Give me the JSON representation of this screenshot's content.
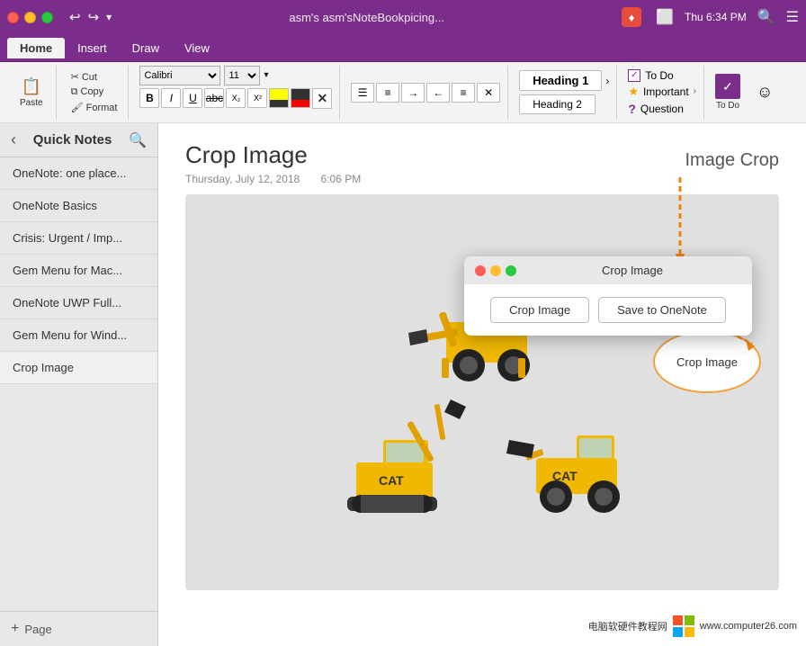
{
  "titlebar": {
    "title": "asm's asm'sNoteBookpicing...",
    "time": "Thu 6:34 PM"
  },
  "ribbon": {
    "tabs": [
      "Home",
      "Insert",
      "Draw",
      "View"
    ],
    "active_tab": "Home",
    "paste_label": "Paste",
    "cut_label": "Cut",
    "copy_label": "Copy",
    "format_label": "Format",
    "font_family": "Calibri",
    "font_size": "11",
    "heading1_label": "Heading 1",
    "heading2_label": "Heading 2",
    "todo_label": "To Do",
    "todo_items": [
      "To Do",
      "Important",
      "Question"
    ]
  },
  "sidebar": {
    "title": "Quick Notes",
    "items": [
      "OneNote: one place...",
      "OneNote Basics",
      "Crisis: Urgent / Imp...",
      "Gem Menu for Mac...",
      "OneNote UWP Full...",
      "Gem Menu for Wind...",
      "Crop Image"
    ],
    "active_item": "Crop Image",
    "add_page_label": "Page"
  },
  "note": {
    "title": "Crop Image",
    "date": "Thursday, July 12, 2018",
    "time": "6:06 PM"
  },
  "crop_popup": {
    "title": "Crop Image",
    "crop_btn": "Crop Image",
    "save_btn": "Save to OneNote"
  },
  "image_crop_label": "Image Crop",
  "callout": {
    "text": "Crop Image"
  },
  "watermark": {
    "site": "www.computer26.com",
    "text": "电脑软硬件教程网"
  }
}
